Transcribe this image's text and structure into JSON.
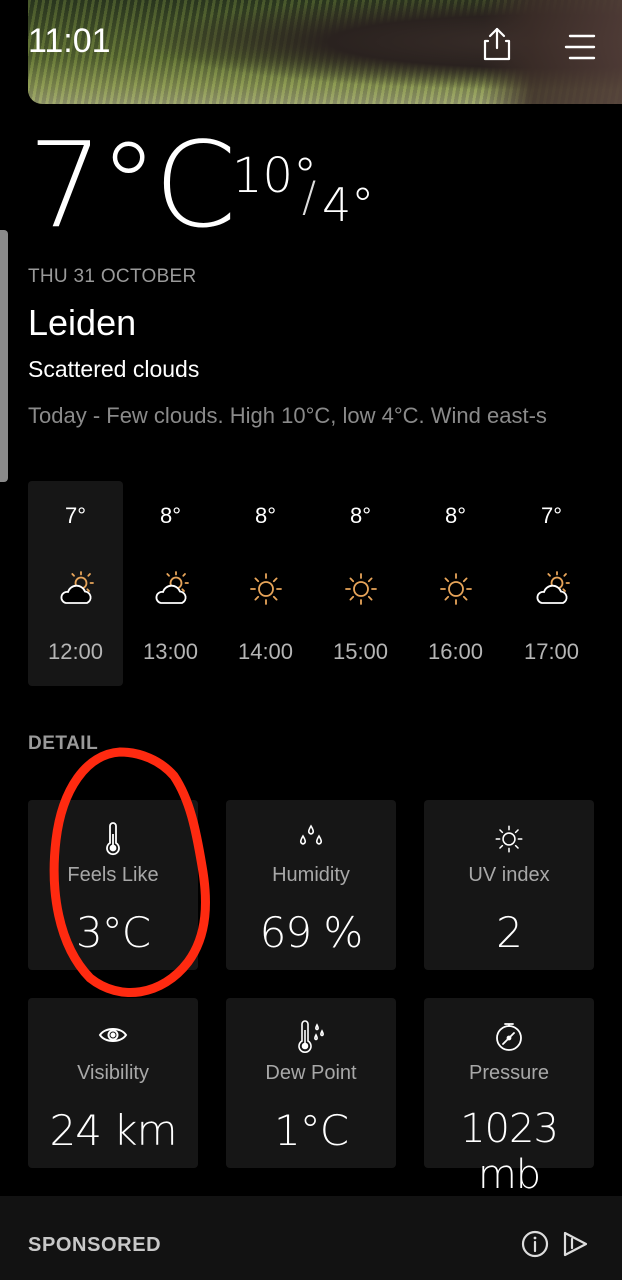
{
  "status": {
    "time": "11:01"
  },
  "current": {
    "temp": "7°C",
    "high": "10°",
    "low": "4°",
    "date": "THU 31 OCTOBER",
    "city": "Leiden",
    "condition": "Scattered clouds",
    "summary": "Today - Few clouds. High 10°C, low 4°C. Wind east-s"
  },
  "hourly": [
    {
      "temp": "7°",
      "icon": "partly-cloudy-icon",
      "time": "12:00"
    },
    {
      "temp": "8°",
      "icon": "partly-cloudy-icon",
      "time": "13:00"
    },
    {
      "temp": "8°",
      "icon": "sun-icon",
      "time": "14:00"
    },
    {
      "temp": "8°",
      "icon": "sun-icon",
      "time": "15:00"
    },
    {
      "temp": "8°",
      "icon": "sun-icon",
      "time": "16:00"
    },
    {
      "temp": "7°",
      "icon": "partly-cloudy-icon",
      "time": "17:00"
    }
  ],
  "details": {
    "title": "DETAIL",
    "cards": [
      {
        "label": "Feels Like",
        "value": "3°C",
        "icon": "thermometer-icon"
      },
      {
        "label": "Humidity",
        "value": "69 %",
        "icon": "droplets-icon"
      },
      {
        "label": "UV index",
        "value": "2",
        "icon": "sun-icon"
      },
      {
        "label": "Visibility",
        "value": "24 km",
        "icon": "eye-icon"
      },
      {
        "label": "Dew Point",
        "value": "1°C",
        "icon": "dew-point-icon"
      },
      {
        "label": "Pressure",
        "value": "1023 mb",
        "icon": "gauge-icon"
      }
    ]
  },
  "sponsored": {
    "label": "SPONSORED"
  },
  "colors": {
    "background": "#000000",
    "card": "#161616",
    "sun": "#e8a55a",
    "annotation": "#ff2a10"
  }
}
